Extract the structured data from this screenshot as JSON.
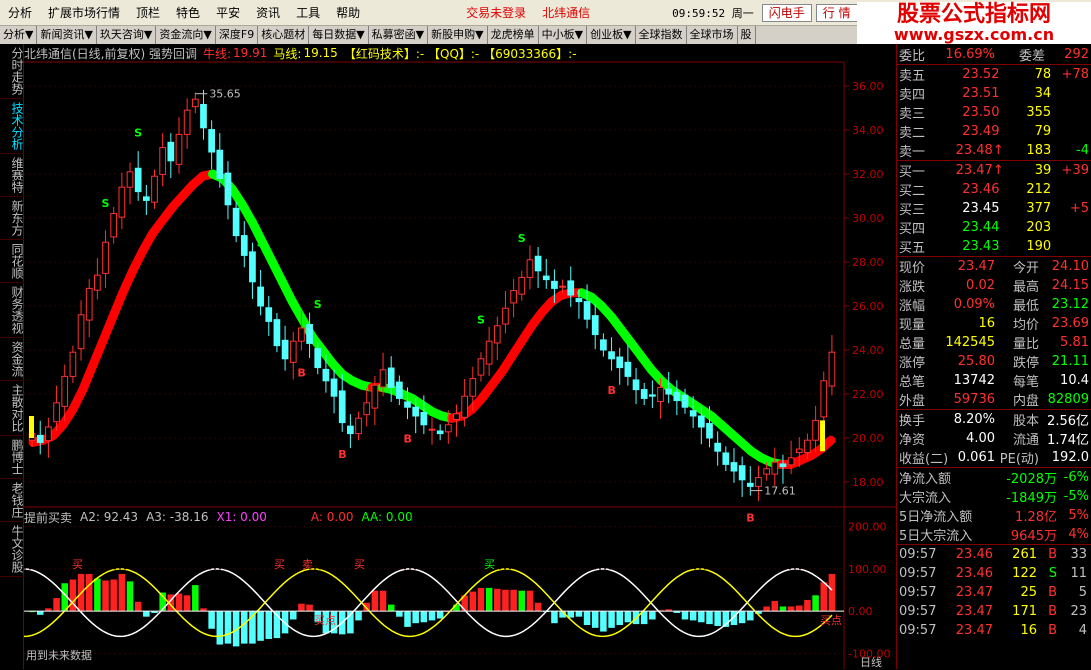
{
  "menu": {
    "items": [
      "分析",
      "扩展市场行情",
      "顶栏",
      "特色",
      "平安",
      "资讯",
      "工具",
      "帮助"
    ],
    "login": "交易未登录",
    "stock": "北纬通信",
    "clock": "09:59:52 周一",
    "buttons": [
      "闪电手",
      "行 情"
    ]
  },
  "tabs": [
    "分析▼",
    "新闻资讯▼",
    "玖天咨询▼",
    "资金流向▼",
    "深度F9",
    "核心题材",
    "每日数据▼",
    "私募密函▼",
    "新股申购▼",
    "龙虎榜单",
    "中小板▼",
    "创业板▼",
    "全球指数",
    "全球市场",
    "股"
  ],
  "watermark": {
    "title": "股票公式指标网",
    "url": "www.gszx.com.cn"
  },
  "leftnav": [
    {
      "label": "分时走势",
      "active": false
    },
    {
      "label": "技术分析",
      "active": true
    },
    {
      "label": "维赛特",
      "active": false
    },
    {
      "label": "新东方",
      "active": false
    },
    {
      "label": "同花顺",
      "active": false
    },
    {
      "label": "财务透视",
      "active": false
    },
    {
      "label": "资金流",
      "active": false
    },
    {
      "label": "主散对比",
      "active": false
    },
    {
      "label": "鹏博士",
      "active": false
    },
    {
      "label": "老钱庄",
      "active": false
    },
    {
      "label": "牛文诊股",
      "active": false
    }
  ],
  "chart_header": {
    "title": "北纬通信(日线,前复权) 强势回调",
    "niu_label": "牛线:",
    "niu_value": "19.91",
    "ma_label": "马线:",
    "ma_value": "19.15",
    "tail": "【红码技术】:- 【QQ】:- 【69033366】:-"
  },
  "sub_header": {
    "title": "提前买卖",
    "a2": "A2: 92.43",
    "a3": "A3: -38.16",
    "x1": "X1: 0.00",
    "a": "A: 0.00",
    "aa": "AA: 0.00",
    "footnote": "用到未来数据",
    "axis_label": "日线"
  },
  "chart_data": [
    {
      "type": "candlestick",
      "title": "北纬通信(日线,前复权) 强势回调",
      "ylim": [
        17.0,
        37.0
      ],
      "yticks": [
        "36.00",
        "34.00",
        "32.00",
        "30.00",
        "28.00",
        "26.00",
        "24.00",
        "22.00",
        "20.00",
        "18.00"
      ],
      "max_label": "35.65",
      "min_label": "17.61",
      "close_series": [
        20.2,
        19.8,
        20.5,
        21.6,
        22.8,
        23.9,
        25.6,
        26.8,
        27.4,
        28.9,
        30.2,
        31.4,
        32.1,
        31.2,
        30.8,
        31.9,
        33.2,
        32.6,
        33.8,
        34.9,
        35.4,
        34.1,
        33.0,
        31.8,
        30.6,
        29.2,
        28.3,
        27.1,
        26.0,
        25.3,
        24.2,
        23.6,
        24.4,
        25.0,
        24.3,
        23.2,
        22.6,
        21.9,
        20.7,
        20.2,
        20.9,
        21.6,
        22.4,
        23.1,
        22.3,
        21.8,
        21.4,
        21.0,
        20.6,
        20.4,
        20.2,
        20.6,
        21.1,
        21.9,
        22.7,
        23.6,
        24.4,
        25.1,
        25.9,
        26.7,
        27.3,
        28.1,
        27.6,
        27.2,
        26.8,
        26.9,
        26.5,
        26.2,
        25.4,
        24.7,
        24.0,
        23.6,
        23.2,
        22.8,
        22.2,
        21.8,
        21.9,
        22.3,
        22.0,
        21.7,
        21.4,
        21.0,
        20.5,
        20.0,
        19.4,
        18.8,
        18.5,
        18.1,
        17.8,
        18.2,
        18.6,
        18.9,
        18.7,
        19.1,
        19.5,
        19.9,
        20.8,
        22.6,
        23.9
      ],
      "niu_line": [
        19.8,
        19.9,
        20.1,
        20.6,
        21.3,
        22.2,
        23.3,
        24.4,
        25.5,
        26.6,
        27.6,
        28.5,
        29.3,
        29.9,
        30.5,
        31.0,
        31.5,
        31.9,
        32.0,
        31.8,
        31.3,
        30.6,
        29.8,
        28.9,
        28.0,
        27.1,
        26.2,
        25.4,
        24.6,
        24.0,
        23.4,
        22.9,
        22.6,
        22.4,
        22.3,
        22.3,
        22.2,
        22.0,
        21.8,
        21.5,
        21.2,
        21.0,
        20.9,
        21.0,
        21.3,
        21.8,
        22.4,
        23.0,
        23.7,
        24.4,
        25.1,
        25.7,
        26.2,
        26.5,
        26.6,
        26.6,
        26.4,
        26.0,
        25.5,
        24.9,
        24.3,
        23.7,
        23.1,
        22.6,
        22.2,
        21.9,
        21.6,
        21.3,
        21.0,
        20.6,
        20.2,
        19.8,
        19.4,
        19.1,
        18.9,
        18.8,
        18.8,
        19.0,
        19.2,
        19.5,
        19.9
      ]
    },
    {
      "type": "bar",
      "title": "提前买卖",
      "ylim": [
        -130,
        230
      ],
      "yticks": [
        "200.00",
        "100.00",
        "0.00",
        "-100.00"
      ],
      "signal_labels": [
        "买",
        "卖",
        "买",
        "卖",
        "卖",
        "买点",
        "买点"
      ]
    }
  ],
  "quote": {
    "wb": {
      "label": "委比",
      "value": "16.69%",
      "label2": "委差",
      "value2": "292"
    },
    "sell": [
      {
        "label": "卖五",
        "price": "23.52",
        "vol": "78",
        "chg": "+78"
      },
      {
        "label": "卖四",
        "price": "23.51",
        "vol": "34",
        "chg": ""
      },
      {
        "label": "卖三",
        "price": "23.50",
        "vol": "355",
        "chg": ""
      },
      {
        "label": "卖二",
        "price": "23.49",
        "vol": "79",
        "chg": ""
      },
      {
        "label": "卖一",
        "price": "23.48↑",
        "vol": "183",
        "chg": "-4"
      }
    ],
    "buy": [
      {
        "label": "买一",
        "price": "23.47↑",
        "vol": "39",
        "chg": "+39"
      },
      {
        "label": "买二",
        "price": "23.46",
        "vol": "212",
        "chg": ""
      },
      {
        "label": "买三",
        "price": "23.45",
        "vol": "377",
        "chg": "+5"
      },
      {
        "label": "买四",
        "price": "23.44",
        "vol": "203",
        "chg": ""
      },
      {
        "label": "买五",
        "price": "23.43",
        "vol": "190",
        "chg": ""
      }
    ],
    "stats": [
      {
        "l1": "现价",
        "v1": "23.47",
        "l2": "今开",
        "v2": "24.10"
      },
      {
        "l1": "涨跌",
        "v1": "0.02",
        "l2": "最高",
        "v2": "24.15"
      },
      {
        "l1": "涨幅",
        "v1": "0.09%",
        "l2": "最低",
        "v2": "23.12"
      },
      {
        "l1": "现量",
        "v1": "16",
        "l2": "均价",
        "v2": "23.69"
      },
      {
        "l1": "总量",
        "v1": "142545",
        "l2": "量比",
        "v2": "5.81"
      },
      {
        "l1": "涨停",
        "v1": "25.80",
        "l2": "跌停",
        "v2": "21.11"
      },
      {
        "l1": "总笔",
        "v1": "13742",
        "l2": "每笔",
        "v2": "10.4"
      },
      {
        "l1": "外盘",
        "v1": "59736",
        "l2": "内盘",
        "v2": "82809"
      }
    ],
    "stats2": [
      {
        "l1": "换手",
        "v1": "8.20%",
        "l2": "股本",
        "v2": "2.56亿"
      },
      {
        "l1": "净资",
        "v1": "4.00",
        "l2": "流通",
        "v2": "1.74亿"
      },
      {
        "l1": "收益(二)",
        "v1": "0.061",
        "l2": "PE(动)",
        "v2": "192.0"
      }
    ],
    "flows": [
      {
        "label": "净流入额",
        "value": "-2028万",
        "pct": "-6%"
      },
      {
        "label": "大宗流入",
        "value": "-1849万",
        "pct": "-5%"
      },
      {
        "label": "5日净流入额",
        "value": "1.28亿",
        "pct": "5%"
      },
      {
        "label": "5日大宗流入",
        "value": "9645万",
        "pct": "4%"
      }
    ],
    "ticks": [
      {
        "time": "09:57",
        "price": "23.46",
        "vol": "261",
        "side": "B",
        "n": "33"
      },
      {
        "time": "09:57",
        "price": "23.46",
        "vol": "122",
        "side": "S",
        "n": "11"
      },
      {
        "time": "09:57",
        "price": "23.47",
        "vol": "25",
        "side": "B",
        "n": "5"
      },
      {
        "time": "09:57",
        "price": "23.47",
        "vol": "171",
        "side": "B",
        "n": "23"
      },
      {
        "time": "09:57",
        "price": "23.47",
        "vol": "16",
        "side": "B",
        "n": "4"
      }
    ]
  },
  "colors": {
    "up": "#ff3030",
    "down": "#54ffff",
    "niu_up": "#ff0000",
    "niu_down": "#00ff00",
    "green": "#00ff00",
    "yellow": "#ffff00",
    "frame": "#800000"
  }
}
